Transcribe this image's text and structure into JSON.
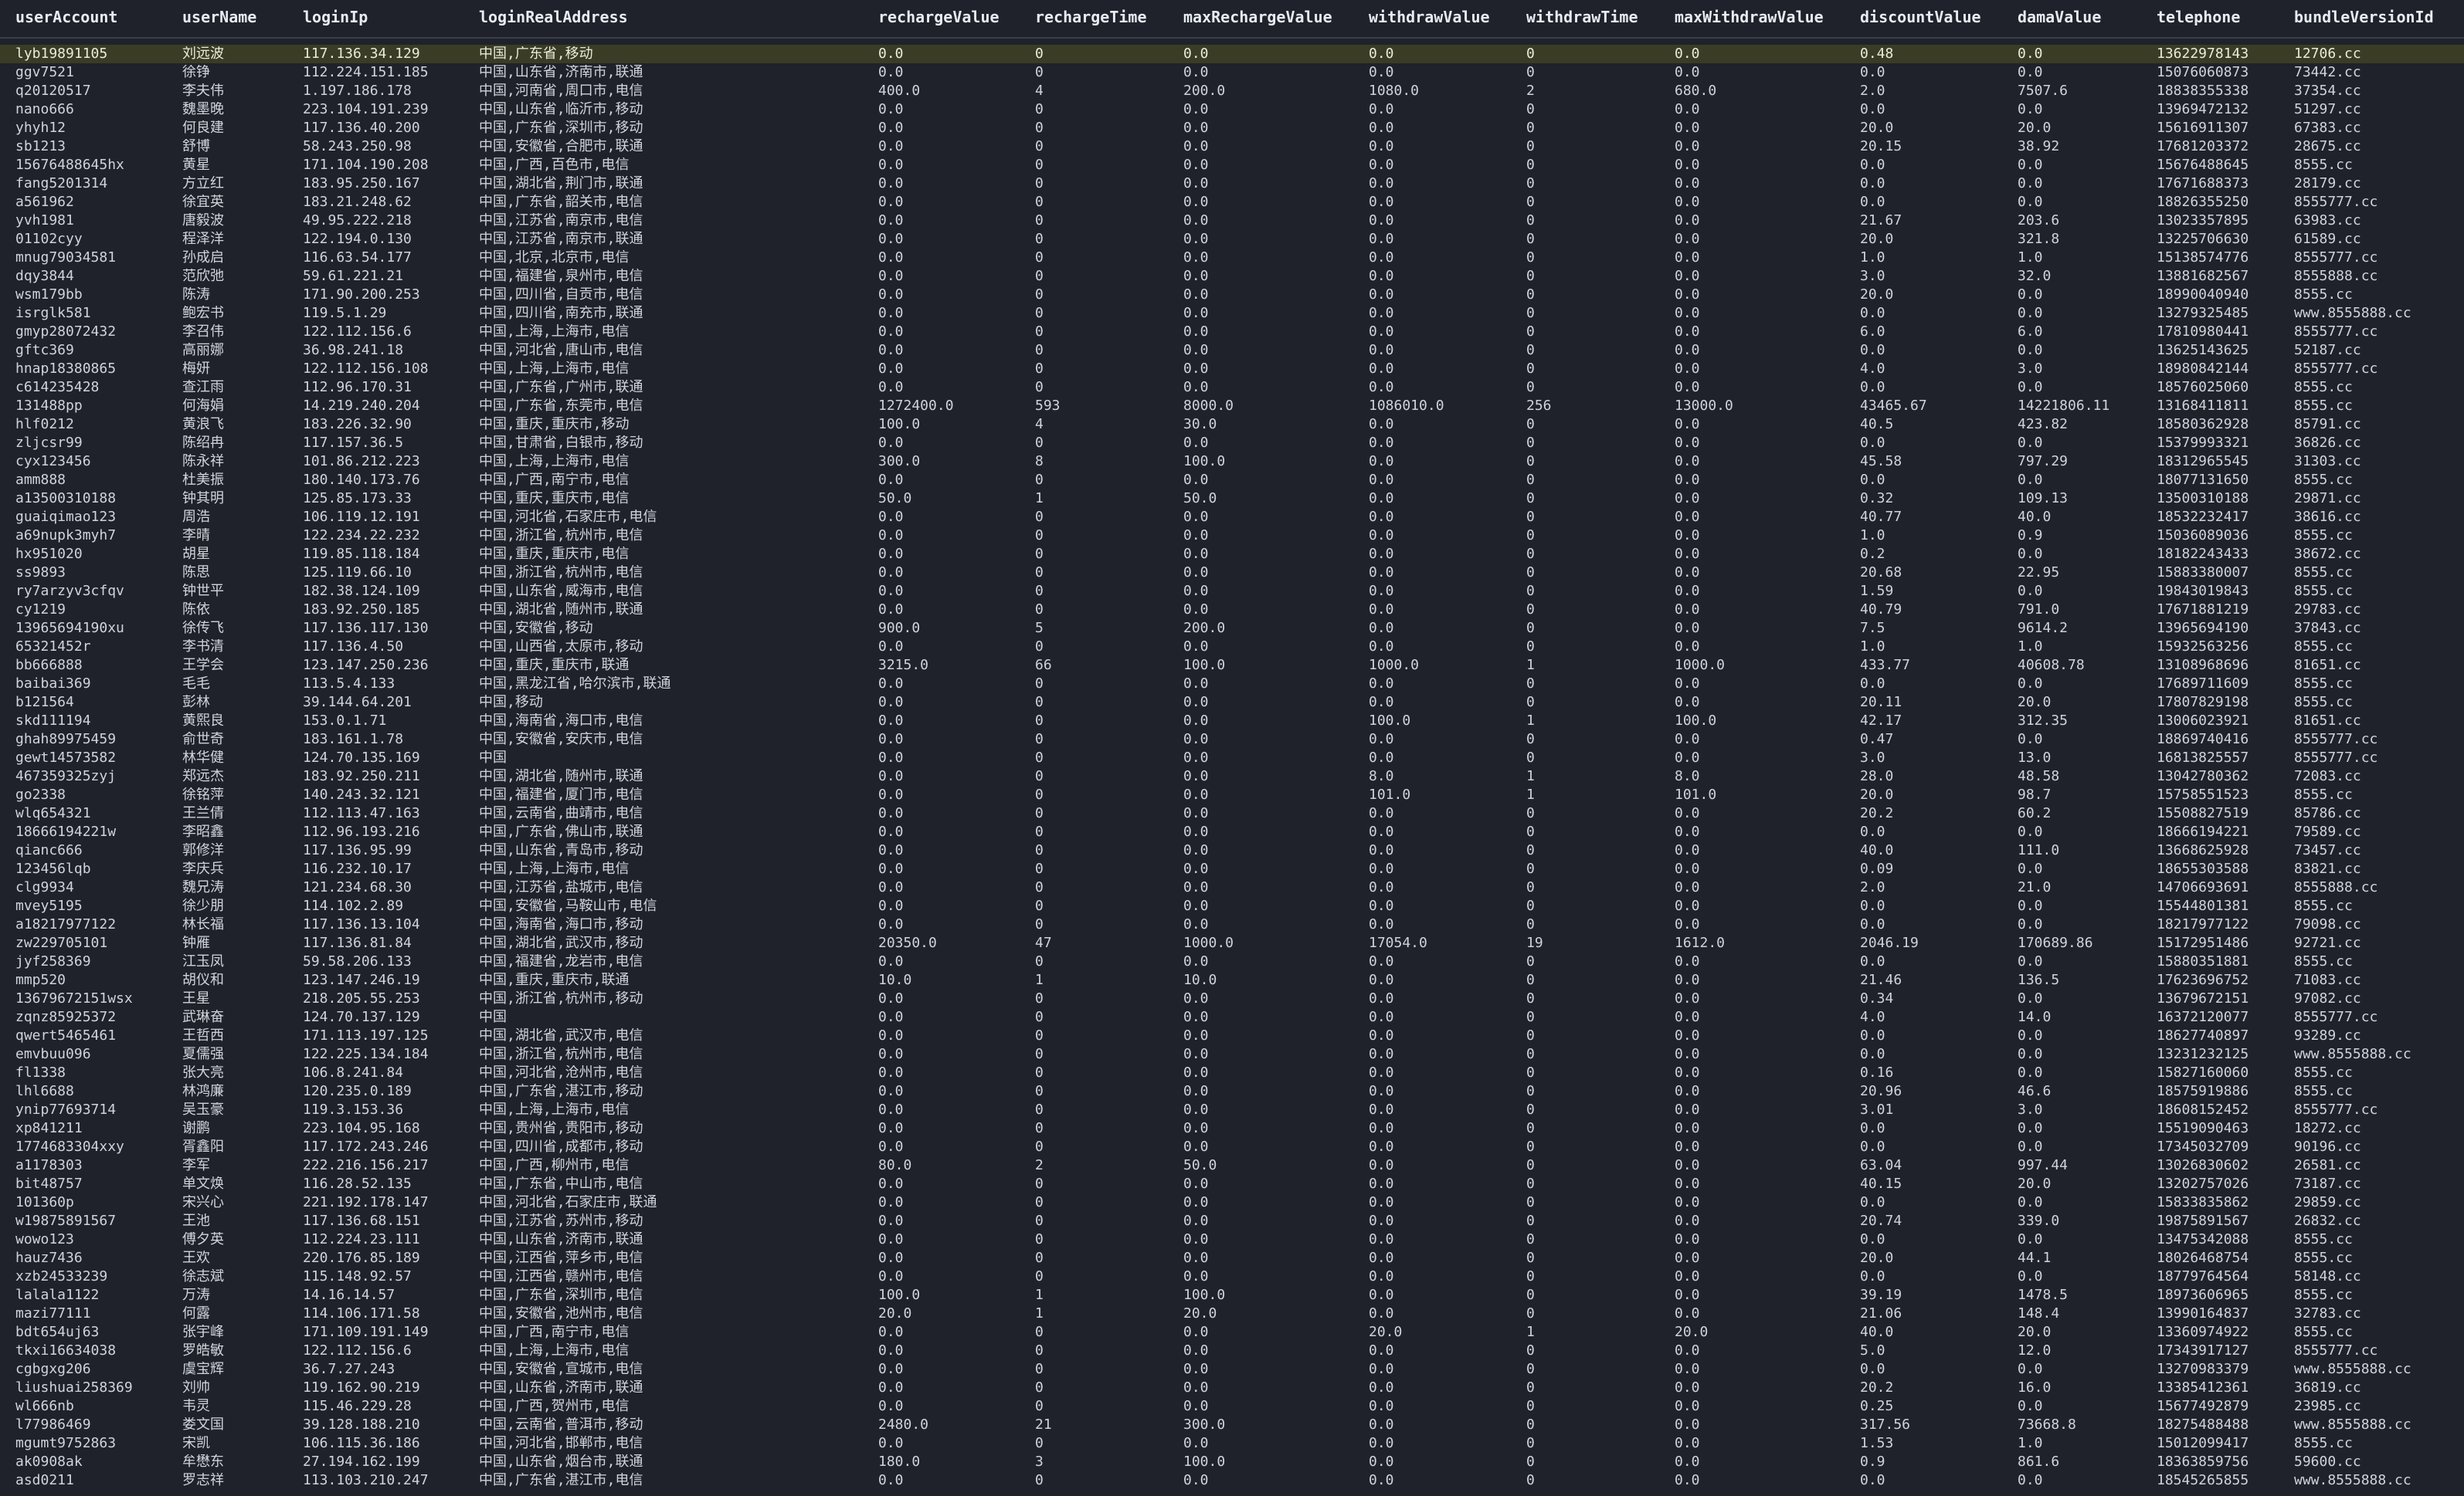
{
  "columns": [
    "userAccount",
    "userName",
    "loginIp",
    "loginRealAddress",
    "rechargeValue",
    "rechargeTime",
    "maxRechargeValue",
    "withdrawValue",
    "withdrawTime",
    "maxWithdrawValue",
    "discountValue",
    "damaValue",
    "telephone",
    "bundleVersionId"
  ],
  "selected_row_index": 0,
  "rows": [
    [
      "lyb19891105",
      "刘远波",
      "117.136.34.129",
      "中国,广东省,移动",
      "0.0",
      "0",
      "0.0",
      "0.0",
      "0",
      "0.0",
      "0.48",
      "0.0",
      "13622978143",
      "12706.cc"
    ],
    [
      "ggv7521",
      "徐铮",
      "112.224.151.185",
      "中国,山东省,济南市,联通",
      "0.0",
      "0",
      "0.0",
      "0.0",
      "0",
      "0.0",
      "0.0",
      "0.0",
      "15076060873",
      "73442.cc"
    ],
    [
      "q20120517",
      "李夫伟",
      "1.197.186.178",
      "中国,河南省,周口市,电信",
      "400.0",
      "4",
      "200.0",
      "1080.0",
      "2",
      "680.0",
      "2.0",
      "7507.6",
      "18838355338",
      "37354.cc"
    ],
    [
      "nano666",
      "魏墨晚",
      "223.104.191.239",
      "中国,山东省,临沂市,移动",
      "0.0",
      "0",
      "0.0",
      "0.0",
      "0",
      "0.0",
      "0.0",
      "0.0",
      "13969472132",
      "51297.cc"
    ],
    [
      "yhyh12",
      "何良建",
      "117.136.40.200",
      "中国,广东省,深圳市,移动",
      "0.0",
      "0",
      "0.0",
      "0.0",
      "0",
      "0.0",
      "20.0",
      "20.0",
      "15616911307",
      "67383.cc"
    ],
    [
      "sb1213",
      "舒博",
      "58.243.250.98",
      "中国,安徽省,合肥市,联通",
      "0.0",
      "0",
      "0.0",
      "0.0",
      "0",
      "0.0",
      "20.15",
      "38.92",
      "17681203372",
      "28675.cc"
    ],
    [
      "15676488645hx",
      "黄星",
      "171.104.190.208",
      "中国,广西,百色市,电信",
      "0.0",
      "0",
      "0.0",
      "0.0",
      "0",
      "0.0",
      "0.0",
      "0.0",
      "15676488645",
      "8555.cc"
    ],
    [
      "fang5201314",
      "方立红",
      "183.95.250.167",
      "中国,湖北省,荆门市,联通",
      "0.0",
      "0",
      "0.0",
      "0.0",
      "0",
      "0.0",
      "0.0",
      "0.0",
      "17671688373",
      "28179.cc"
    ],
    [
      "a561962",
      "徐宜英",
      "183.21.248.62",
      "中国,广东省,韶关市,电信",
      "0.0",
      "0",
      "0.0",
      "0.0",
      "0",
      "0.0",
      "0.0",
      "0.0",
      "18826355250",
      "8555777.cc"
    ],
    [
      "yvh1981",
      "唐毅波",
      "49.95.222.218",
      "中国,江苏省,南京市,电信",
      "0.0",
      "0",
      "0.0",
      "0.0",
      "0",
      "0.0",
      "21.67",
      "203.6",
      "13023357895",
      "63983.cc"
    ],
    [
      "01102cyy",
      "程泽洋",
      "122.194.0.130",
      "中国,江苏省,南京市,联通",
      "0.0",
      "0",
      "0.0",
      "0.0",
      "0",
      "0.0",
      "20.0",
      "321.8",
      "13225706630",
      "61589.cc"
    ],
    [
      "mnug79034581",
      "孙成启",
      "116.63.54.177",
      "中国,北京,北京市,电信",
      "0.0",
      "0",
      "0.0",
      "0.0",
      "0",
      "0.0",
      "1.0",
      "1.0",
      "15138574776",
      "8555777.cc"
    ],
    [
      "dqy3844",
      "范欣弛",
      "59.61.221.21",
      "中国,福建省,泉州市,电信",
      "0.0",
      "0",
      "0.0",
      "0.0",
      "0",
      "0.0",
      "3.0",
      "32.0",
      "13881682567",
      "8555888.cc"
    ],
    [
      "wsm179bb",
      "陈涛",
      "171.90.200.253",
      "中国,四川省,自贡市,电信",
      "0.0",
      "0",
      "0.0",
      "0.0",
      "0",
      "0.0",
      "20.0",
      "0.0",
      "18990040940",
      "8555.cc"
    ],
    [
      "isrglk581",
      "鲍宏书",
      "119.5.1.29",
      "中国,四川省,南充市,联通",
      "0.0",
      "0",
      "0.0",
      "0.0",
      "0",
      "0.0",
      "0.0",
      "0.0",
      "13279325485",
      "www.8555888.cc"
    ],
    [
      "gmyp28072432",
      "李召伟",
      "122.112.156.6",
      "中国,上海,上海市,电信",
      "0.0",
      "0",
      "0.0",
      "0.0",
      "0",
      "0.0",
      "6.0",
      "6.0",
      "17810980441",
      "8555777.cc"
    ],
    [
      "gftc369",
      "高丽娜",
      "36.98.241.18",
      "中国,河北省,唐山市,电信",
      "0.0",
      "0",
      "0.0",
      "0.0",
      "0",
      "0.0",
      "0.0",
      "0.0",
      "13625143625",
      "52187.cc"
    ],
    [
      "hnap18380865",
      "梅妍",
      "122.112.156.108",
      "中国,上海,上海市,电信",
      "0.0",
      "0",
      "0.0",
      "0.0",
      "0",
      "0.0",
      "4.0",
      "3.0",
      "18980842144",
      "8555777.cc"
    ],
    [
      "c614235428",
      "查江雨",
      "112.96.170.31",
      "中国,广东省,广州市,联通",
      "0.0",
      "0",
      "0.0",
      "0.0",
      "0",
      "0.0",
      "0.0",
      "0.0",
      "18576025060",
      "8555.cc"
    ],
    [
      "131488pp",
      "何海娟",
      "14.219.240.204",
      "中国,广东省,东莞市,电信",
      "1272400.0",
      "593",
      "8000.0",
      "1086010.0",
      "256",
      "13000.0",
      "43465.67",
      "14221806.11",
      "13168411811",
      "8555.cc"
    ],
    [
      "hlf0212",
      "黄浪飞",
      "183.226.32.90",
      "中国,重庆,重庆市,移动",
      "100.0",
      "4",
      "30.0",
      "0.0",
      "0",
      "0.0",
      "40.5",
      "423.82",
      "18580362928",
      "85791.cc"
    ],
    [
      "zljcsr99",
      "陈绍冉",
      "117.157.36.5",
      "中国,甘肃省,白银市,移动",
      "0.0",
      "0",
      "0.0",
      "0.0",
      "0",
      "0.0",
      "0.0",
      "0.0",
      "15379993321",
      "36826.cc"
    ],
    [
      "cyx123456",
      "陈永祥",
      "101.86.212.223",
      "中国,上海,上海市,电信",
      "300.0",
      "8",
      "100.0",
      "0.0",
      "0",
      "0.0",
      "45.58",
      "797.29",
      "18312965545",
      "31303.cc"
    ],
    [
      "amm888",
      "杜美振",
      "180.140.173.76",
      "中国,广西,南宁市,电信",
      "0.0",
      "0",
      "0.0",
      "0.0",
      "0",
      "0.0",
      "0.0",
      "0.0",
      "18077131650",
      "8555.cc"
    ],
    [
      "a13500310188",
      "钟其明",
      "125.85.173.33",
      "中国,重庆,重庆市,电信",
      "50.0",
      "1",
      "50.0",
      "0.0",
      "0",
      "0.0",
      "0.32",
      "109.13",
      "13500310188",
      "29871.cc"
    ],
    [
      "guaiqimao123",
      "周浩",
      "106.119.12.191",
      "中国,河北省,石家庄市,电信",
      "0.0",
      "0",
      "0.0",
      "0.0",
      "0",
      "0.0",
      "40.77",
      "40.0",
      "18532232417",
      "38616.cc"
    ],
    [
      "a69nupk3myh7",
      "李晴",
      "122.234.22.232",
      "中国,浙江省,杭州市,电信",
      "0.0",
      "0",
      "0.0",
      "0.0",
      "0",
      "0.0",
      "1.0",
      "0.9",
      "15036089036",
      "8555.cc"
    ],
    [
      "hx951020",
      "胡星",
      "119.85.118.184",
      "中国,重庆,重庆市,电信",
      "0.0",
      "0",
      "0.0",
      "0.0",
      "0",
      "0.0",
      "0.2",
      "0.0",
      "18182243433",
      "38672.cc"
    ],
    [
      "ss9893",
      "陈思",
      "125.119.66.10",
      "中国,浙江省,杭州市,电信",
      "0.0",
      "0",
      "0.0",
      "0.0",
      "0",
      "0.0",
      "20.68",
      "22.95",
      "15883380007",
      "8555.cc"
    ],
    [
      "ry7arzyv3cfqv",
      "钟世平",
      "182.38.124.109",
      "中国,山东省,威海市,电信",
      "0.0",
      "0",
      "0.0",
      "0.0",
      "0",
      "0.0",
      "1.59",
      "0.0",
      "19843019843",
      "8555.cc"
    ],
    [
      "cy1219",
      "陈依",
      "183.92.250.185",
      "中国,湖北省,随州市,联通",
      "0.0",
      "0",
      "0.0",
      "0.0",
      "0",
      "0.0",
      "40.79",
      "791.0",
      "17671881219",
      "29783.cc"
    ],
    [
      "13965694190xu",
      "徐传飞",
      "117.136.117.130",
      "中国,安徽省,移动",
      "900.0",
      "5",
      "200.0",
      "0.0",
      "0",
      "0.0",
      "7.5",
      "9614.2",
      "13965694190",
      "37843.cc"
    ],
    [
      "65321452r",
      "李书清",
      "117.136.4.50",
      "中国,山西省,太原市,移动",
      "0.0",
      "0",
      "0.0",
      "0.0",
      "0",
      "0.0",
      "1.0",
      "1.0",
      "15932563256",
      "8555.cc"
    ],
    [
      "bb666888",
      "王学会",
      "123.147.250.236",
      "中国,重庆,重庆市,联通",
      "3215.0",
      "66",
      "100.0",
      "1000.0",
      "1",
      "1000.0",
      "433.77",
      "40608.78",
      "13108968696",
      "81651.cc"
    ],
    [
      "baibai369",
      "毛毛",
      "113.5.4.133",
      "中国,黑龙江省,哈尔滨市,联通",
      "0.0",
      "0",
      "0.0",
      "0.0",
      "0",
      "0.0",
      "0.0",
      "0.0",
      "17689711609",
      "8555.cc"
    ],
    [
      "b121564",
      "彭林",
      "39.144.64.201",
      "中国,移动",
      "0.0",
      "0",
      "0.0",
      "0.0",
      "0",
      "0.0",
      "20.11",
      "20.0",
      "17807829198",
      "8555.cc"
    ],
    [
      "skd111194",
      "黄熙良",
      "153.0.1.71",
      "中国,海南省,海口市,电信",
      "0.0",
      "0",
      "0.0",
      "100.0",
      "1",
      "100.0",
      "42.17",
      "312.35",
      "13006023921",
      "81651.cc"
    ],
    [
      "ghah89975459",
      "俞世奇",
      "183.161.1.78",
      "中国,安徽省,安庆市,电信",
      "0.0",
      "0",
      "0.0",
      "0.0",
      "0",
      "0.0",
      "0.47",
      "0.0",
      "18869740416",
      "8555777.cc"
    ],
    [
      "gewt14573582",
      "林华健",
      "124.70.135.169",
      "中国",
      "0.0",
      "0",
      "0.0",
      "0.0",
      "0",
      "0.0",
      "3.0",
      "13.0",
      "16813825557",
      "8555777.cc"
    ],
    [
      "467359325zyj",
      "郑远杰",
      "183.92.250.211",
      "中国,湖北省,随州市,联通",
      "0.0",
      "0",
      "0.0",
      "8.0",
      "1",
      "8.0",
      "28.0",
      "48.58",
      "13042780362",
      "72083.cc"
    ],
    [
      "go2338",
      "徐铭萍",
      "140.243.32.121",
      "中国,福建省,厦门市,电信",
      "0.0",
      "0",
      "0.0",
      "101.0",
      "1",
      "101.0",
      "20.0",
      "98.7",
      "15758551523",
      "8555.cc"
    ],
    [
      "wlq654321",
      "王兰倩",
      "112.113.47.163",
      "中国,云南省,曲靖市,电信",
      "0.0",
      "0",
      "0.0",
      "0.0",
      "0",
      "0.0",
      "20.2",
      "60.2",
      "15508827519",
      "85786.cc"
    ],
    [
      "18666194221w",
      "李昭鑫",
      "112.96.193.216",
      "中国,广东省,佛山市,联通",
      "0.0",
      "0",
      "0.0",
      "0.0",
      "0",
      "0.0",
      "0.0",
      "0.0",
      "18666194221",
      "79589.cc"
    ],
    [
      "qianc666",
      "郭修洋",
      "117.136.95.99",
      "中国,山东省,青岛市,移动",
      "0.0",
      "0",
      "0.0",
      "0.0",
      "0",
      "0.0",
      "40.0",
      "111.0",
      "13668625928",
      "73457.cc"
    ],
    [
      "123456lqb",
      "李庆兵",
      "116.232.10.17",
      "中国,上海,上海市,电信",
      "0.0",
      "0",
      "0.0",
      "0.0",
      "0",
      "0.0",
      "0.09",
      "0.0",
      "18655303588",
      "83821.cc"
    ],
    [
      "clg9934",
      "魏兄涛",
      "121.234.68.30",
      "中国,江苏省,盐城市,电信",
      "0.0",
      "0",
      "0.0",
      "0.0",
      "0",
      "0.0",
      "2.0",
      "21.0",
      "14706693691",
      "8555888.cc"
    ],
    [
      "mvey5195",
      "徐少朋",
      "114.102.2.89",
      "中国,安徽省,马鞍山市,电信",
      "0.0",
      "0",
      "0.0",
      "0.0",
      "0",
      "0.0",
      "0.0",
      "0.0",
      "15544801381",
      "8555.cc"
    ],
    [
      "a18217977122",
      "林长福",
      "117.136.13.104",
      "中国,海南省,海口市,移动",
      "0.0",
      "0",
      "0.0",
      "0.0",
      "0",
      "0.0",
      "0.0",
      "0.0",
      "18217977122",
      "79098.cc"
    ],
    [
      "zw229705101",
      "钟雁",
      "117.136.81.84",
      "中国,湖北省,武汉市,移动",
      "20350.0",
      "47",
      "1000.0",
      "17054.0",
      "19",
      "1612.0",
      "2046.19",
      "170689.86",
      "15172951486",
      "92721.cc"
    ],
    [
      "jyf258369",
      "江玉凤",
      "59.58.206.133",
      "中国,福建省,龙岩市,电信",
      "0.0",
      "0",
      "0.0",
      "0.0",
      "0",
      "0.0",
      "0.0",
      "0.0",
      "15880351881",
      "8555.cc"
    ],
    [
      "mmp520",
      "胡仪和",
      "123.147.246.19",
      "中国,重庆,重庆市,联通",
      "10.0",
      "1",
      "10.0",
      "0.0",
      "0",
      "0.0",
      "21.46",
      "136.5",
      "17623696752",
      "71083.cc"
    ],
    [
      "13679672151wsx",
      "王星",
      "218.205.55.253",
      "中国,浙江省,杭州市,移动",
      "0.0",
      "0",
      "0.0",
      "0.0",
      "0",
      "0.0",
      "0.34",
      "0.0",
      "13679672151",
      "97082.cc"
    ],
    [
      "zqnz85925372",
      "武琳奋",
      "124.70.137.129",
      "中国",
      "0.0",
      "0",
      "0.0",
      "0.0",
      "0",
      "0.0",
      "4.0",
      "14.0",
      "16372120077",
      "8555777.cc"
    ],
    [
      "qwert5465461",
      "王哲西",
      "171.113.197.125",
      "中国,湖北省,武汉市,电信",
      "0.0",
      "0",
      "0.0",
      "0.0",
      "0",
      "0.0",
      "0.0",
      "0.0",
      "18627740897",
      "93289.cc"
    ],
    [
      "emvbuu096",
      "夏儒强",
      "122.225.134.184",
      "中国,浙江省,杭州市,电信",
      "0.0",
      "0",
      "0.0",
      "0.0",
      "0",
      "0.0",
      "0.0",
      "0.0",
      "13231232125",
      "www.8555888.cc"
    ],
    [
      "fl1338",
      "张大亮",
      "106.8.241.84",
      "中国,河北省,沧州市,电信",
      "0.0",
      "0",
      "0.0",
      "0.0",
      "0",
      "0.0",
      "0.16",
      "0.0",
      "15827160060",
      "8555.cc"
    ],
    [
      "lhl6688",
      "林鸿廉",
      "120.235.0.189",
      "中国,广东省,湛江市,移动",
      "0.0",
      "0",
      "0.0",
      "0.0",
      "0",
      "0.0",
      "20.96",
      "46.6",
      "18575919886",
      "8555.cc"
    ],
    [
      "ynip77693714",
      "吴玉豪",
      "119.3.153.36",
      "中国,上海,上海市,电信",
      "0.0",
      "0",
      "0.0",
      "0.0",
      "0",
      "0.0",
      "3.01",
      "3.0",
      "18608152452",
      "8555777.cc"
    ],
    [
      "xp841211",
      "谢鹏",
      "223.104.95.168",
      "中国,贵州省,贵阳市,移动",
      "0.0",
      "0",
      "0.0",
      "0.0",
      "0",
      "0.0",
      "0.0",
      "0.0",
      "15519090463",
      "18272.cc"
    ],
    [
      "1774683304xxy",
      "胥鑫阳",
      "117.172.243.246",
      "中国,四川省,成都市,移动",
      "0.0",
      "0",
      "0.0",
      "0.0",
      "0",
      "0.0",
      "0.0",
      "0.0",
      "17345032709",
      "90196.cc"
    ],
    [
      "a1178303",
      "李军",
      "222.216.156.217",
      "中国,广西,柳州市,电信",
      "80.0",
      "2",
      "50.0",
      "0.0",
      "0",
      "0.0",
      "63.04",
      "997.44",
      "13026830602",
      "26581.cc"
    ],
    [
      "bit48757",
      "单文焕",
      "116.28.52.135",
      "中国,广东省,中山市,电信",
      "0.0",
      "0",
      "0.0",
      "0.0",
      "0",
      "0.0",
      "40.15",
      "20.0",
      "13202757026",
      "73187.cc"
    ],
    [
      "101360p",
      "宋兴心",
      "221.192.178.147",
      "中国,河北省,石家庄市,联通",
      "0.0",
      "0",
      "0.0",
      "0.0",
      "0",
      "0.0",
      "0.0",
      "0.0",
      "15833835862",
      "29859.cc"
    ],
    [
      "w19875891567",
      "王池",
      "117.136.68.151",
      "中国,江苏省,苏州市,移动",
      "0.0",
      "0",
      "0.0",
      "0.0",
      "0",
      "0.0",
      "20.74",
      "339.0",
      "19875891567",
      "26832.cc"
    ],
    [
      "wowo123",
      "傅夕英",
      "112.224.23.111",
      "中国,山东省,济南市,联通",
      "0.0",
      "0",
      "0.0",
      "0.0",
      "0",
      "0.0",
      "0.0",
      "0.0",
      "13475342088",
      "8555.cc"
    ],
    [
      "hauz7436",
      "王欢",
      "220.176.85.189",
      "中国,江西省,萍乡市,电信",
      "0.0",
      "0",
      "0.0",
      "0.0",
      "0",
      "0.0",
      "20.0",
      "44.1",
      "18026468754",
      "8555.cc"
    ],
    [
      "xzb24533239",
      "徐志斌",
      "115.148.92.57",
      "中国,江西省,赣州市,电信",
      "0.0",
      "0",
      "0.0",
      "0.0",
      "0",
      "0.0",
      "0.0",
      "0.0",
      "18779764564",
      "58148.cc"
    ],
    [
      "lalala1122",
      "万涛",
      "14.16.14.57",
      "中国,广东省,深圳市,电信",
      "100.0",
      "1",
      "100.0",
      "0.0",
      "0",
      "0.0",
      "39.19",
      "1478.5",
      "18973606965",
      "8555.cc"
    ],
    [
      "mazi77111",
      "何露",
      "114.106.171.58",
      "中国,安徽省,池州市,电信",
      "20.0",
      "1",
      "20.0",
      "0.0",
      "0",
      "0.0",
      "21.06",
      "148.4",
      "13990164837",
      "32783.cc"
    ],
    [
      "bdt654uj63",
      "张宇峰",
      "171.109.191.149",
      "中国,广西,南宁市,电信",
      "0.0",
      "0",
      "0.0",
      "20.0",
      "1",
      "20.0",
      "40.0",
      "20.0",
      "13360974922",
      "8555.cc"
    ],
    [
      "tkxi16634038",
      "罗皓敏",
      "122.112.156.6",
      "中国,上海,上海市,电信",
      "0.0",
      "0",
      "0.0",
      "0.0",
      "0",
      "0.0",
      "5.0",
      "12.0",
      "17343917127",
      "8555777.cc"
    ],
    [
      "cgbgxg206",
      "虞宝辉",
      "36.7.27.243",
      "中国,安徽省,宣城市,电信",
      "0.0",
      "0",
      "0.0",
      "0.0",
      "0",
      "0.0",
      "0.0",
      "0.0",
      "13270983379",
      "www.8555888.cc"
    ],
    [
      "liushuai258369",
      "刘帅",
      "119.162.90.219",
      "中国,山东省,济南市,联通",
      "0.0",
      "0",
      "0.0",
      "0.0",
      "0",
      "0.0",
      "20.2",
      "16.0",
      "13385412361",
      "36819.cc"
    ],
    [
      "wl666nb",
      "韦灵",
      "115.46.229.28",
      "中国,广西,贺州市,电信",
      "0.0",
      "0",
      "0.0",
      "0.0",
      "0",
      "0.0",
      "0.25",
      "0.0",
      "15677492879",
      "23985.cc"
    ],
    [
      "l77986469",
      "娄文国",
      "39.128.188.210",
      "中国,云南省,普洱市,移动",
      "2480.0",
      "21",
      "300.0",
      "0.0",
      "0",
      "0.0",
      "317.56",
      "73668.8",
      "18275488488",
      "www.8555888.cc"
    ],
    [
      "mgumt9752863",
      "宋凯",
      "106.115.36.186",
      "中国,河北省,邯郸市,电信",
      "0.0",
      "0",
      "0.0",
      "0.0",
      "0",
      "0.0",
      "1.53",
      "1.0",
      "15012099417",
      "8555.cc"
    ],
    [
      "ak0908ak",
      "牟懋东",
      "27.194.162.199",
      "中国,山东省,烟台市,联通",
      "180.0",
      "3",
      "100.0",
      "0.0",
      "0",
      "0.0",
      "0.9",
      "861.6",
      "18363859756",
      "59600.cc"
    ],
    [
      "asd0211",
      "罗志祥",
      "113.103.210.247",
      "中国,广东省,湛江市,电信",
      "0.0",
      "0",
      "0.0",
      "0.0",
      "0",
      "0.0",
      "0.0",
      "0.0",
      "18545265855",
      "www.8555888.cc"
    ]
  ],
  "colors": {
    "background": "#1f222a",
    "selected_row": "#3a3c26",
    "header_text": "#e7ecf2",
    "cell_text": "#cfd4db"
  }
}
